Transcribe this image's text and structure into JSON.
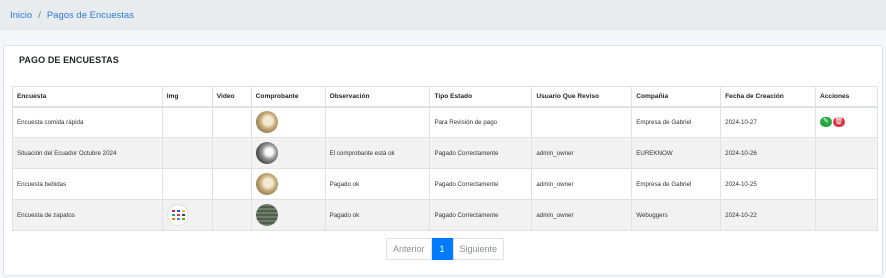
{
  "breadcrumb": {
    "home": "Inicio",
    "separator": "/",
    "current": "Pagos de Encuestas"
  },
  "card": {
    "title": "PAGO DE ENCUESTAS"
  },
  "table": {
    "headers": [
      "Encuesta",
      "Img",
      "Video",
      "Comprobante",
      "Observación",
      "Tipo Estado",
      "Usuario Que Reviso",
      "Compañia",
      "Fecha de Creación",
      "Acciones"
    ],
    "rows": [
      {
        "encuesta": "Encuesta comida rápida",
        "has_img": false,
        "comprobante": "tan-photo",
        "observacion": "",
        "tipo_estado": "Para Revisión de pago",
        "usuario": "",
        "compania": "Empresa de Gabriel",
        "fecha": "2024-10-27",
        "actions": [
          "edit-icon",
          "trash-icon"
        ]
      },
      {
        "encuesta": "Situación del Ecuador Octubre 2024",
        "has_img": false,
        "comprobante": "grey-photo",
        "observacion": "El comprobante está ok",
        "tipo_estado": "Pagado Correctamente",
        "usuario": "admin_owner",
        "compania": "EUREKNOW",
        "fecha": "2024-10-26",
        "actions": []
      },
      {
        "encuesta": "Encuesta bebidas",
        "has_img": false,
        "comprobante": "tan-photo",
        "observacion": "Pagado ok",
        "tipo_estado": "Pagado Correctamente",
        "usuario": "admin_owner",
        "compania": "Empresa de Gabriel",
        "fecha": "2024-10-25",
        "actions": []
      },
      {
        "encuesta": "Encuesta de zapatos",
        "has_img": true,
        "comprobante": "green-photo",
        "observacion": "Pagado ok",
        "tipo_estado": "Pagado Correctamente",
        "usuario": "admin_owner",
        "compania": "Webuggers",
        "fecha": "2024-10-22",
        "actions": []
      }
    ]
  },
  "pagination": {
    "prev": "Anterior",
    "current": "1",
    "next": "Siguiente"
  },
  "colors": {
    "accent": "#007bff",
    "link": "#2f7dd9",
    "edit": "#28a745",
    "delete": "#dc3545"
  }
}
